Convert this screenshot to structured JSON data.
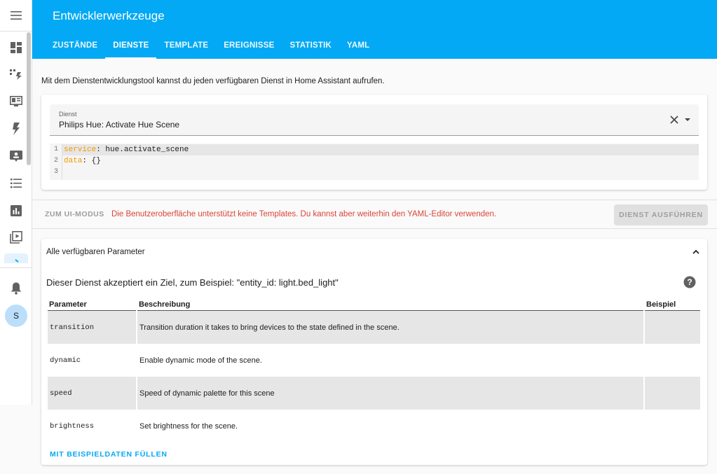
{
  "header": {
    "title": "Entwicklerwerkzeuge",
    "tabs": [
      {
        "label": "ZUSTÄNDE",
        "active": false
      },
      {
        "label": "DIENSTE",
        "active": true
      },
      {
        "label": "TEMPLATE",
        "active": false
      },
      {
        "label": "EREIGNISSE",
        "active": false
      },
      {
        "label": "STATISTIK",
        "active": false
      },
      {
        "label": "YAML",
        "active": false
      }
    ]
  },
  "sidebar": {
    "items": [
      "menu-icon",
      "overview-icon",
      "energy-icon",
      "map-icon",
      "logbook-icon",
      "history-icon",
      "todo-list-icon",
      "statistics-icon",
      "media-icon",
      "developer-tools-icon"
    ],
    "notifications_icon": "bell-icon",
    "user_initial": "S"
  },
  "intro_text": "Mit dem Dienstentwicklungstool kannst du jeden verfügbaren Dienst in Home Assistant aufrufen.",
  "service_field": {
    "label": "Dienst",
    "value": "Philips Hue: Activate Hue Scene"
  },
  "code_editor": {
    "lines": [
      {
        "num": "1",
        "key": "service",
        "rest": ": hue.activate_scene"
      },
      {
        "num": "2",
        "key": "data",
        "rest": ": {}"
      },
      {
        "num": "3",
        "key": "",
        "rest": ""
      }
    ]
  },
  "actions": {
    "ui_mode_label": "ZUM UI-MODUS",
    "error_text": "Die Benutzeroberfläche unterstützt keine Templates. Du kannst aber weiterhin den YAML-Editor verwenden.",
    "run_label": "DIENST AUSFÜHREN"
  },
  "params_panel": {
    "title": "Alle verfügbaren Parameter",
    "target_text": "Dieser Dienst akzeptiert ein Ziel, zum Beispiel: \"entity_id: light.bed_light\"",
    "columns": [
      "Parameter",
      "Beschreibung",
      "Beispiel"
    ],
    "rows": [
      {
        "param": "transition",
        "description": "Transition duration it takes to bring devices to the state defined in the scene.",
        "example": ""
      },
      {
        "param": "dynamic",
        "description": "Enable dynamic mode of the scene.",
        "example": ""
      },
      {
        "param": "speed",
        "description": "Speed of dynamic palette for this scene",
        "example": ""
      },
      {
        "param": "brightness",
        "description": "Set brightness for the scene.",
        "example": ""
      }
    ],
    "fill_label": "MIT BEISPIELDATEN FÜLLEN"
  },
  "colors": {
    "primary": "#03a9f4",
    "error": "#db4437",
    "yaml_key": "#f29a00"
  }
}
